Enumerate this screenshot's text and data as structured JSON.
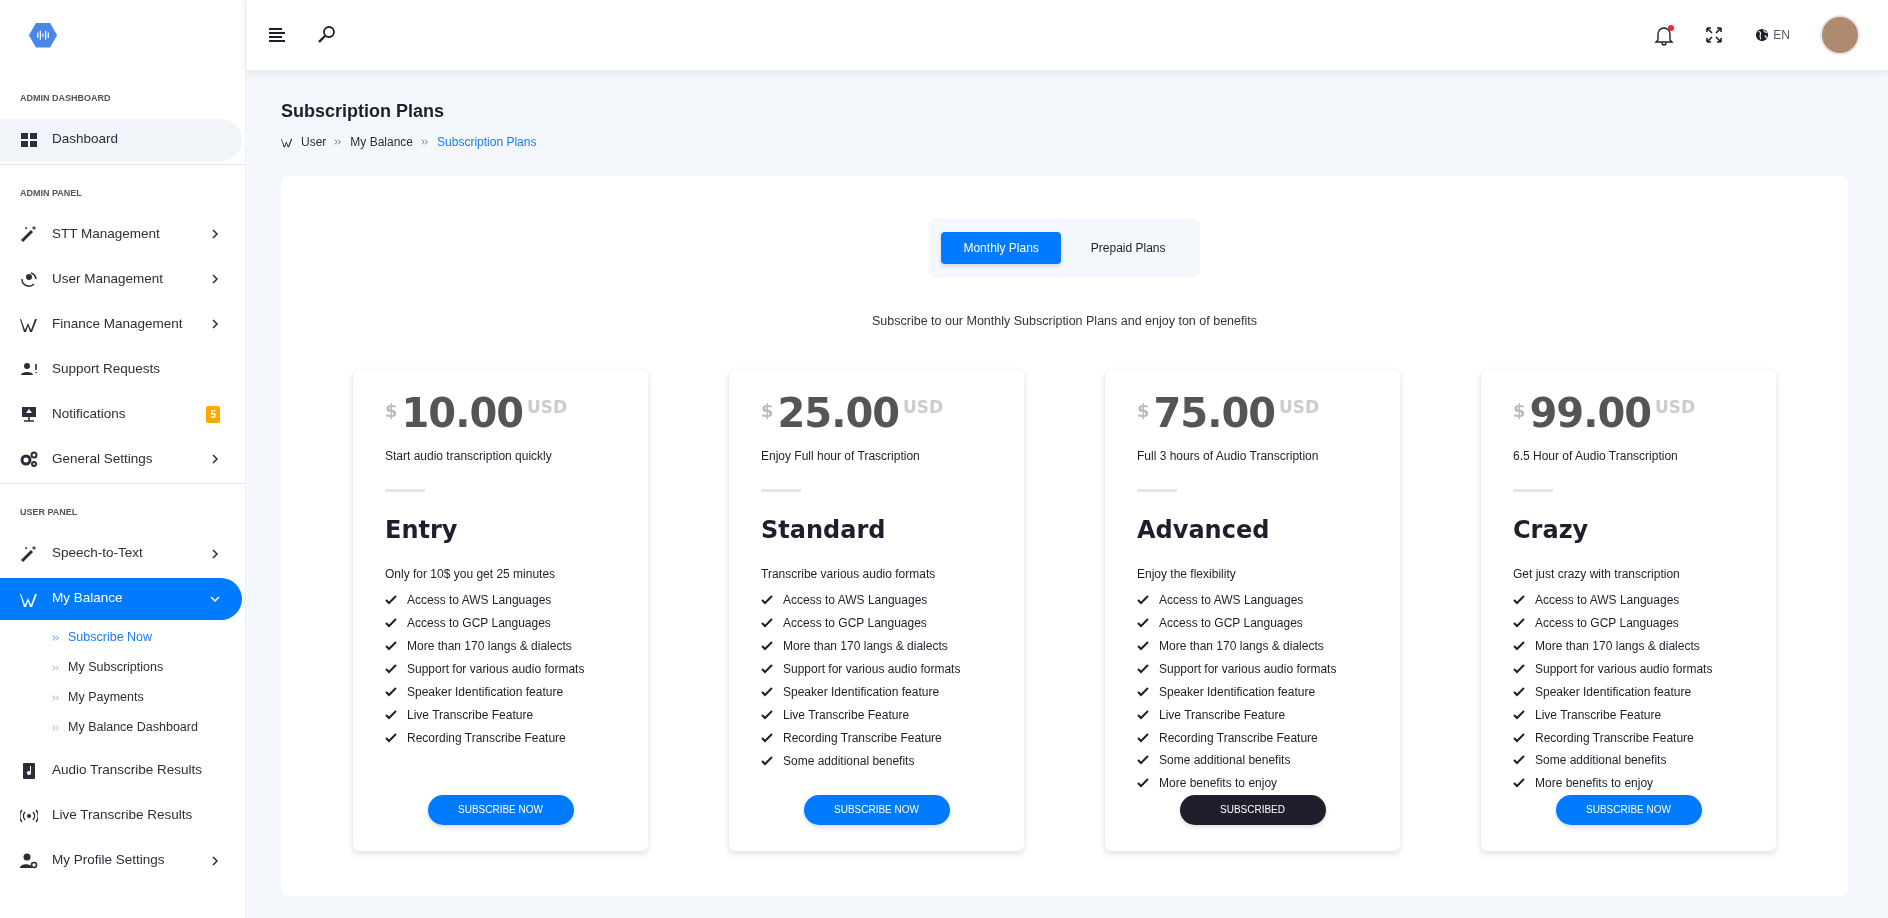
{
  "header": {
    "notifications": {
      "unread": true
    },
    "language": "EN"
  },
  "sidebar": {
    "sections": [
      {
        "title": "ADMIN DASHBOARD",
        "items": [
          {
            "label": "Dashboard",
            "hovered": true,
            "selected": false,
            "has_submenu": false
          }
        ]
      },
      {
        "title": "ADMIN PANEL",
        "items": [
          {
            "label": "STT Management",
            "hovered": false,
            "selected": false,
            "has_submenu": true,
            "expanded": false
          },
          {
            "label": "User Management",
            "hovered": false,
            "selected": false,
            "has_submenu": true,
            "expanded": false
          },
          {
            "label": "Finance Management",
            "hovered": false,
            "selected": false,
            "has_submenu": true,
            "expanded": false
          },
          {
            "label": "Support Requests",
            "hovered": false,
            "selected": false,
            "has_submenu": false
          },
          {
            "label": "Notifications",
            "hovered": false,
            "selected": false,
            "has_submenu": false,
            "badge": "5"
          },
          {
            "label": "General Settings",
            "hovered": false,
            "selected": false,
            "has_submenu": true,
            "expanded": false
          }
        ]
      },
      {
        "title": "USER PANEL",
        "items": [
          {
            "label": "Speech-to-Text",
            "hovered": false,
            "selected": false,
            "has_submenu": true,
            "expanded": false
          },
          {
            "label": "My Balance",
            "hovered": false,
            "selected": true,
            "has_submenu": true,
            "expanded": true,
            "children": [
              {
                "label": "Subscribe Now",
                "selected": true
              },
              {
                "label": "My Subscriptions",
                "selected": false
              },
              {
                "label": "My Payments",
                "selected": false
              },
              {
                "label": "My Balance Dashboard",
                "selected": false
              }
            ]
          },
          {
            "label": "Audio Transcribe Results",
            "hovered": false,
            "selected": false,
            "has_submenu": false
          },
          {
            "label": "Live Transcribe Results",
            "hovered": false,
            "selected": false,
            "has_submenu": false
          },
          {
            "label": "My Profile Settings",
            "hovered": false,
            "selected": false,
            "has_submenu": true,
            "expanded": false
          }
        ]
      }
    ]
  },
  "page": {
    "title": "Subscription Plans",
    "breadcrumb": [
      {
        "label": "User",
        "current": false
      },
      {
        "label": "My Balance",
        "current": false
      },
      {
        "label": "Subscription Plans",
        "current": true
      }
    ]
  },
  "plan_tabs": [
    {
      "label": "Monthly Plans",
      "selected": true
    },
    {
      "label": "Prepaid Plans",
      "selected": false
    }
  ],
  "intro": "Subscribe to our Monthly Subscription Plans and enjoy ton of benefits",
  "plans": [
    {
      "symbol": "$",
      "price": "10.00",
      "currency": "USD",
      "tagline": "Start audio transcription quickly",
      "name": "Entry",
      "summary": "Only for 10$ you get 25 minutes",
      "features": [
        "Access to AWS Languages",
        "Access to GCP Languages",
        "More than 170 langs & dialects",
        "Support for various audio formats",
        "Speaker Identification feature",
        "Live Transcribe Feature",
        "Recording Transcribe Feature"
      ],
      "button": {
        "label": "SUBSCRIBE NOW",
        "subscribed": false
      }
    },
    {
      "symbol": "$",
      "price": "25.00",
      "currency": "USD",
      "tagline": "Enjoy Full hour of Trascription",
      "name": "Standard",
      "summary": "Transcribe various audio formats",
      "features": [
        "Access to AWS Languages",
        "Access to GCP Languages",
        "More than 170 langs & dialects",
        "Support for various audio formats",
        "Speaker Identification feature",
        "Live Transcribe Feature",
        "Recording Transcribe Feature",
        "Some additional benefits"
      ],
      "button": {
        "label": "SUBSCRIBE NOW",
        "subscribed": false
      }
    },
    {
      "symbol": "$",
      "price": "75.00",
      "currency": "USD",
      "tagline": "Full 3 hours of Audio Transcription",
      "name": "Advanced",
      "summary": "Enjoy the flexibility",
      "features": [
        "Access to AWS Languages",
        "Access to GCP Languages",
        "More than 170 langs & dialects",
        "Support for various audio formats",
        "Speaker Identification feature",
        "Live Transcribe Feature",
        "Recording Transcribe Feature",
        "Some additional benefits",
        "More benefits to enjoy"
      ],
      "button": {
        "label": "SUBSCRIBED",
        "subscribed": true
      }
    },
    {
      "symbol": "$",
      "price": "99.00",
      "currency": "USD",
      "tagline": "6.5 Hour of Audio Transcription",
      "name": "Crazy",
      "summary": "Get just crazy with transcription",
      "features": [
        "Access to AWS Languages",
        "Access to GCP Languages",
        "More than 170 langs & dialects",
        "Support for various audio formats",
        "Speaker Identification feature",
        "Live Transcribe Feature",
        "Recording Transcribe Feature",
        "Some additional benefits",
        "More benefits to enjoy"
      ],
      "button": {
        "label": "SUBSCRIBE NOW",
        "subscribed": false
      }
    }
  ]
}
